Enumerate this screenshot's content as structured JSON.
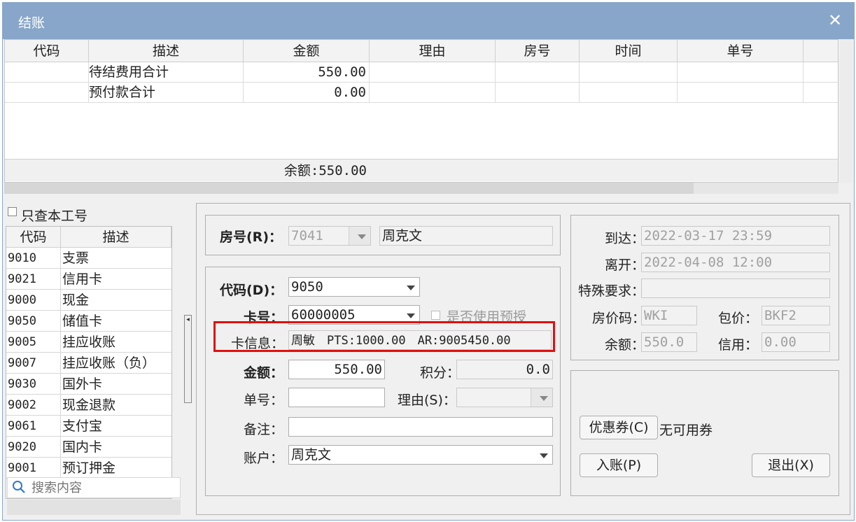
{
  "window": {
    "title": "结账",
    "close_icon": "close-icon"
  },
  "grid": {
    "columns": [
      "代码",
      "描述",
      "金额",
      "理由",
      "房号",
      "时间",
      "单号"
    ],
    "rows": [
      {
        "code": "",
        "desc": "待结费用合计",
        "amount": "550.00",
        "reason": "",
        "room": "",
        "time": "",
        "no": ""
      },
      {
        "code": "",
        "desc": "预付款合计",
        "amount": "0.00",
        "reason": "",
        "room": "",
        "time": "",
        "no": ""
      }
    ],
    "balance": "余额:550.00"
  },
  "left": {
    "only_my_id_label": "只查本工号",
    "columns": [
      "代码",
      "描述"
    ],
    "items": [
      {
        "code": "9010",
        "desc": "支票"
      },
      {
        "code": "9021",
        "desc": "信用卡"
      },
      {
        "code": "9000",
        "desc": "现金"
      },
      {
        "code": "9050",
        "desc": "储值卡"
      },
      {
        "code": "9005",
        "desc": "挂应收账"
      },
      {
        "code": "9007",
        "desc": "挂应收账（负）"
      },
      {
        "code": "9030",
        "desc": "国外卡"
      },
      {
        "code": "9002",
        "desc": "现金退款"
      },
      {
        "code": "9061",
        "desc": "支付宝"
      },
      {
        "code": "9020",
        "desc": "国内卡"
      },
      {
        "code": "9001",
        "desc": "预订押金"
      }
    ],
    "search_placeholder": "搜索内容"
  },
  "form": {
    "room_label": "房号(R)：",
    "room_value": "7041",
    "guest_name": "周克文",
    "code_label": "代码(D)：",
    "code_value": "9050",
    "card_label": "卡号：",
    "card_value": "60000005",
    "use_preauth_label": "是否使用预授",
    "card_info_label": "卡信息：",
    "card_info_value": "周敏　PTS:1000.00　AR:9005450.00",
    "amount_label": "金额：",
    "amount_value": "550.00",
    "points_label": "积分：",
    "points_value": "0.0",
    "docno_label": "单号：",
    "docno_value": "",
    "reason_label": "理由(S)：",
    "reason_value": "",
    "note_label": "备注：",
    "note_value": "",
    "account_label": "账户：",
    "account_value": "周克文"
  },
  "info": {
    "arrive_label": "到达：",
    "arrive_value": "2022-03-17 23:59",
    "depart_label": "离开：",
    "depart_value": "2022-04-08 12:00",
    "special_label": "特殊要求：",
    "special_value": "",
    "rate_code_label": "房价码：",
    "rate_code_value": "WKI",
    "package_label": "包价：",
    "package_value": "BKF2",
    "balance_label": "余额：",
    "balance_value": "550.0",
    "credit_label": "信用：",
    "credit_value": "0.00"
  },
  "actions": {
    "coupon_button": "优惠券(C)",
    "coupon_status": "无可用券",
    "post_button": "入账(P)",
    "exit_button": "退出(X)"
  }
}
